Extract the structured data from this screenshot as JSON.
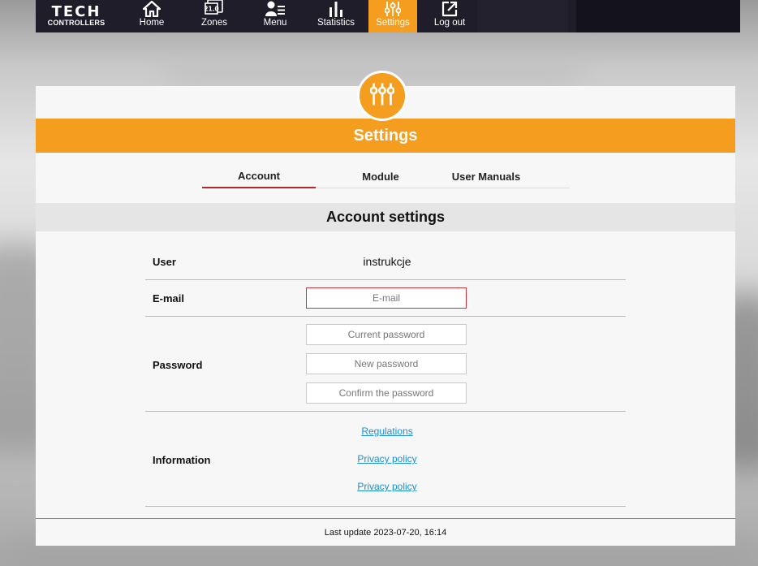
{
  "brand": {
    "logo_main": "TECH",
    "logo_sub": "CONTROLLERS"
  },
  "nav": {
    "home": "Home",
    "zones": "Zones",
    "zones_icon_value": "21.0",
    "menu": "Menu",
    "statistics": "Statistics",
    "settings": "Settings",
    "logout": "Log out"
  },
  "page": {
    "title": "Settings",
    "tabs": {
      "account": "Account",
      "module": "Module",
      "user_manuals": "User Manuals"
    },
    "section_title": "Account settings"
  },
  "account": {
    "user_label": "User",
    "user_value": "instrukcje",
    "email_label": "E-mail",
    "email_placeholder": "E-mail",
    "password_label": "Password",
    "current_password_placeholder": "Current password",
    "new_password_placeholder": "New password",
    "confirm_password_placeholder": "Confirm the password",
    "information_label": "Information",
    "links": {
      "regulations": "Regulations",
      "privacy_policy_1": "Privacy policy",
      "privacy_policy_2": "Privacy policy"
    }
  },
  "footer": {
    "last_update": "Last update 2023-07-20, 16:14"
  },
  "colors": {
    "accent": "#f49d1e",
    "navbar": "#1f1d29",
    "active_tab_underline": "#b3282d",
    "invalid_border": "#d0303a",
    "link": "#1a8fd6"
  }
}
